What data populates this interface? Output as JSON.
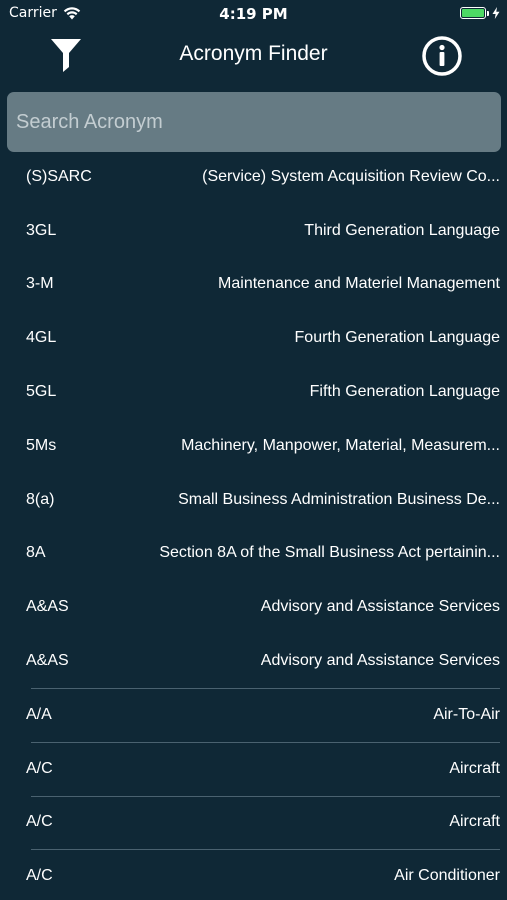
{
  "status_bar": {
    "carrier": "Carrier",
    "time": "4:19 PM",
    "battery_level": 1.0,
    "battery_color": "#4cd964",
    "icons": [
      "wifi-icon",
      "battery-icon",
      "charging-bolt-icon"
    ]
  },
  "nav": {
    "title": "Acronym Finder",
    "left_icon": "filter-icon",
    "right_icon": "info-icon"
  },
  "search": {
    "placeholder": "Search Acronym",
    "value": ""
  },
  "colors": {
    "background": "#0f2836",
    "search_field": "#667b84",
    "separator": "#4a6270",
    "text": "#ffffff"
  },
  "list": [
    {
      "acronym": "(S)SARC",
      "definition": "(Service) System Acquisition Review Co...",
      "separator": false
    },
    {
      "acronym": "3GL",
      "definition": "Third Generation Language",
      "separator": false
    },
    {
      "acronym": "3-M",
      "definition": "Maintenance and Materiel Management",
      "separator": false
    },
    {
      "acronym": "4GL",
      "definition": "Fourth Generation Language",
      "separator": false
    },
    {
      "acronym": "5GL",
      "definition": "Fifth Generation Language",
      "separator": false
    },
    {
      "acronym": "5Ms",
      "definition": "Machinery, Manpower, Material, Measurem...",
      "separator": false
    },
    {
      "acronym": "8(a)",
      "definition": "Small Business Administration Business De...",
      "separator": false
    },
    {
      "acronym": "8A",
      "definition": "Section 8A of the Small Business Act pertainin...",
      "separator": false
    },
    {
      "acronym": "A&AS",
      "definition": "Advisory and Assistance Services",
      "separator": false
    },
    {
      "acronym": "A&AS",
      "definition": "Advisory and Assistance Services",
      "separator": false
    },
    {
      "acronym": "A/A",
      "definition": "Air-To-Air",
      "separator": true
    },
    {
      "acronym": "A/C",
      "definition": "Aircraft",
      "separator": true
    },
    {
      "acronym": "A/C",
      "definition": "Aircraft",
      "separator": true
    },
    {
      "acronym": "A/C",
      "definition": "Air Conditioner",
      "separator": true
    }
  ]
}
